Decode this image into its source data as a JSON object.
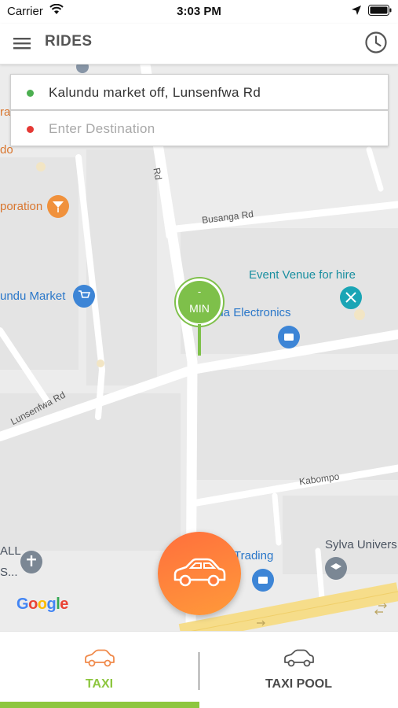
{
  "status_bar": {
    "carrier": "Carrier",
    "time": "3:03 PM",
    "wifi_icon": "wifi-icon",
    "location_icon": "location-arrow-icon",
    "battery_icon": "battery-icon"
  },
  "header": {
    "title": "RIDES",
    "menu_icon": "hamburger-menu-icon",
    "history_icon": "clock-icon"
  },
  "trip": {
    "pickup": "Kalundu market off, Lunsenfwa Rd",
    "destination_placeholder": "Enter Destination",
    "pickup_dot_color": "#4caf50",
    "destination_dot_color": "#e53935"
  },
  "map": {
    "labels": {
      "road_vertical": "Rd",
      "busanga": "Busanga Rd",
      "lunsenfwa": "Lunsenfwa Rd",
      "kabompo": "Kabompo",
      "corporation": "poration",
      "kalundu_market": "undu Market",
      "event_venue": "Event Venue for hire",
      "electronics": "Ra     ida Electronics",
      "trading": "Trading",
      "sylva": "Sylva Univers",
      "all_1": "ALL",
      "all_2": "S...",
      "partial_do": "do",
      "partial_ra": "ra"
    },
    "pin": {
      "eta": "-",
      "unit": "MIN",
      "color": "#7ec04a"
    },
    "google_logo": "Google"
  },
  "fab": {
    "icon": "car-icon",
    "gradient": [
      "#ff6f3d",
      "#ff9a3a"
    ]
  },
  "tabs": {
    "taxi": {
      "label": "TAXI",
      "icon": "car-outline-icon",
      "active": true
    },
    "taxi_pool": {
      "label": "TAXI POOL",
      "icon": "car-outline-icon",
      "active": false
    },
    "active_color": "#8dc63f"
  }
}
